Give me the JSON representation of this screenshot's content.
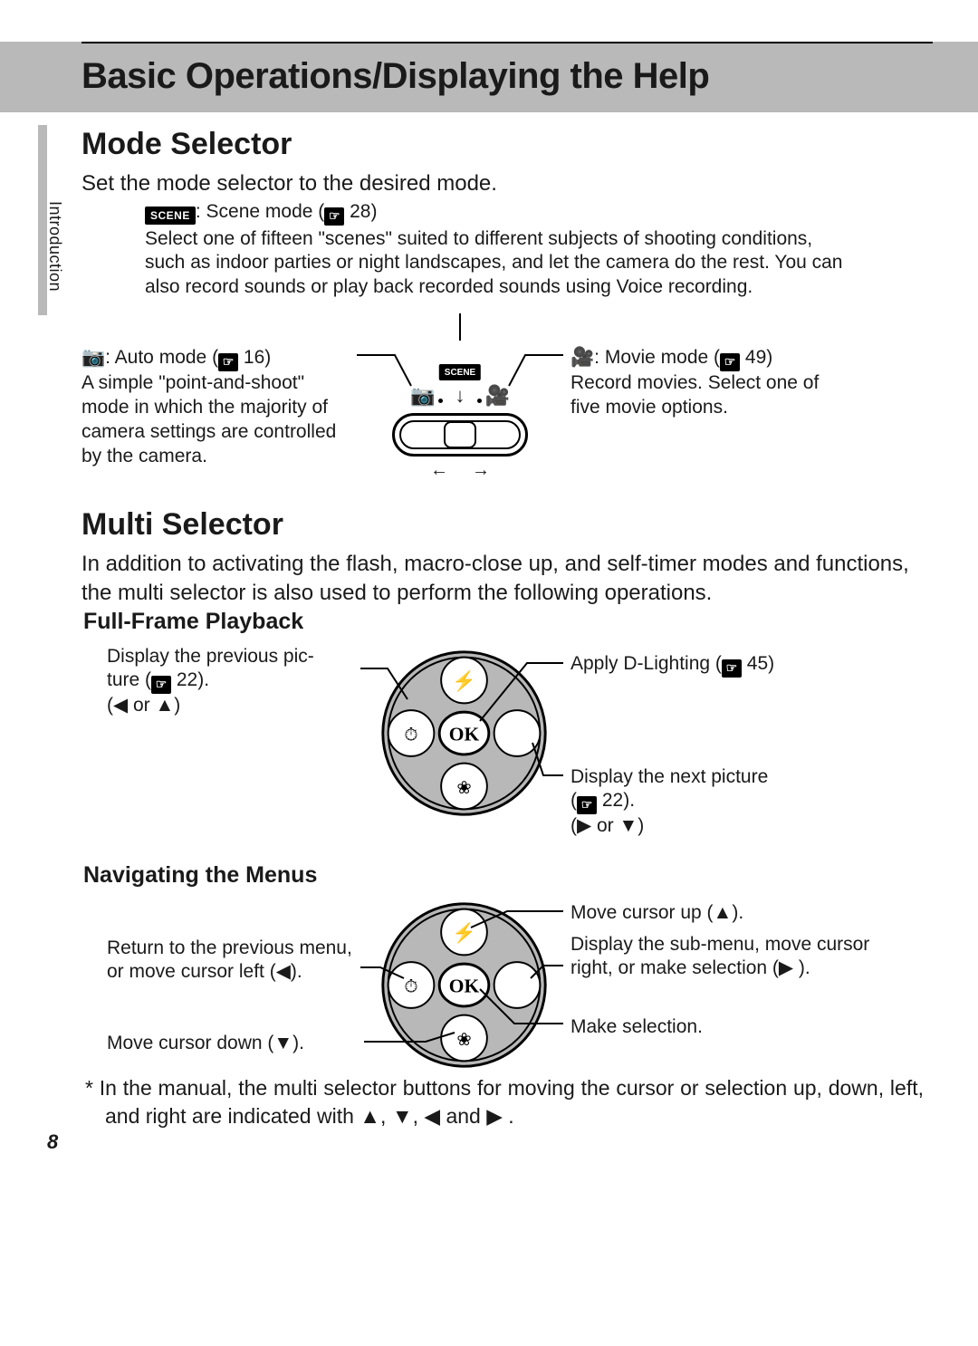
{
  "header": {
    "title": "Basic Operations/Displaying the Help"
  },
  "chapter_tab": "Introduction",
  "page_number": "8",
  "mode_selector": {
    "heading": "Mode Selector",
    "intro": "Set the mode selector to the desired mode.",
    "scene": {
      "label": ": Scene mode (",
      "ref": "28",
      "close": ")",
      "desc": "Select one of fifteen \"scenes\" suited to different subjects of shooting conditions, such as indoor parties or night landscapes, and let the camera do the rest. You can also record sounds or play back recorded sounds using Voice recording."
    },
    "auto": {
      "label_pre": ": Auto mode (",
      "ref": "16",
      "label_post": ")",
      "desc": "A simple \"point-and-shoot\" mode in which the majority of camera settings are controlled by the camera."
    },
    "movie": {
      "label_pre": ": Movie mode (",
      "ref": "49",
      "label_post": ")",
      "desc": "Record movies. Select one of five movie options."
    },
    "dial_scene_badge": "SCENE"
  },
  "multi_selector": {
    "heading": "Multi Selector",
    "intro": "In addition to activating the flash, macro-close up, and self-timer modes and functions, the multi selector is also used to perform the following operations.",
    "full_frame": {
      "heading": "Full-Frame Playback",
      "prev_pre": "Display the previous pic-",
      "prev_line2_pre": "ture (",
      "prev_ref": "22",
      "prev_line2_post": ").",
      "prev_hint": "(◀ or ▲)",
      "dlight_pre": "Apply D-Lighting (",
      "dlight_ref": "45",
      "dlight_post": ")",
      "next_line1": "Display the next picture",
      "next_pre": "(",
      "next_ref": "22",
      "next_post": ").",
      "next_hint": "(▶  or ▼)"
    },
    "nav_menus": {
      "heading": "Navigating the Menus",
      "return_text": "Return to the previous menu, or move cursor left (◀).",
      "down_text": "Move cursor down (▼).",
      "up_text": "Move cursor up (▲).",
      "submenu_text": "Display the sub-menu, move cursor right, or make selection (▶ ).",
      "make_sel": "Make selection."
    },
    "footnote": "In the manual, the multi selector buttons for moving the cursor or selection up, down, left, and right are indicated with ▲, ▼, ◀ and ▶ ."
  },
  "icons": {
    "scene_badge": "SCENE",
    "camera": "◙",
    "movie": "▶▮",
    "ok": "OK"
  }
}
